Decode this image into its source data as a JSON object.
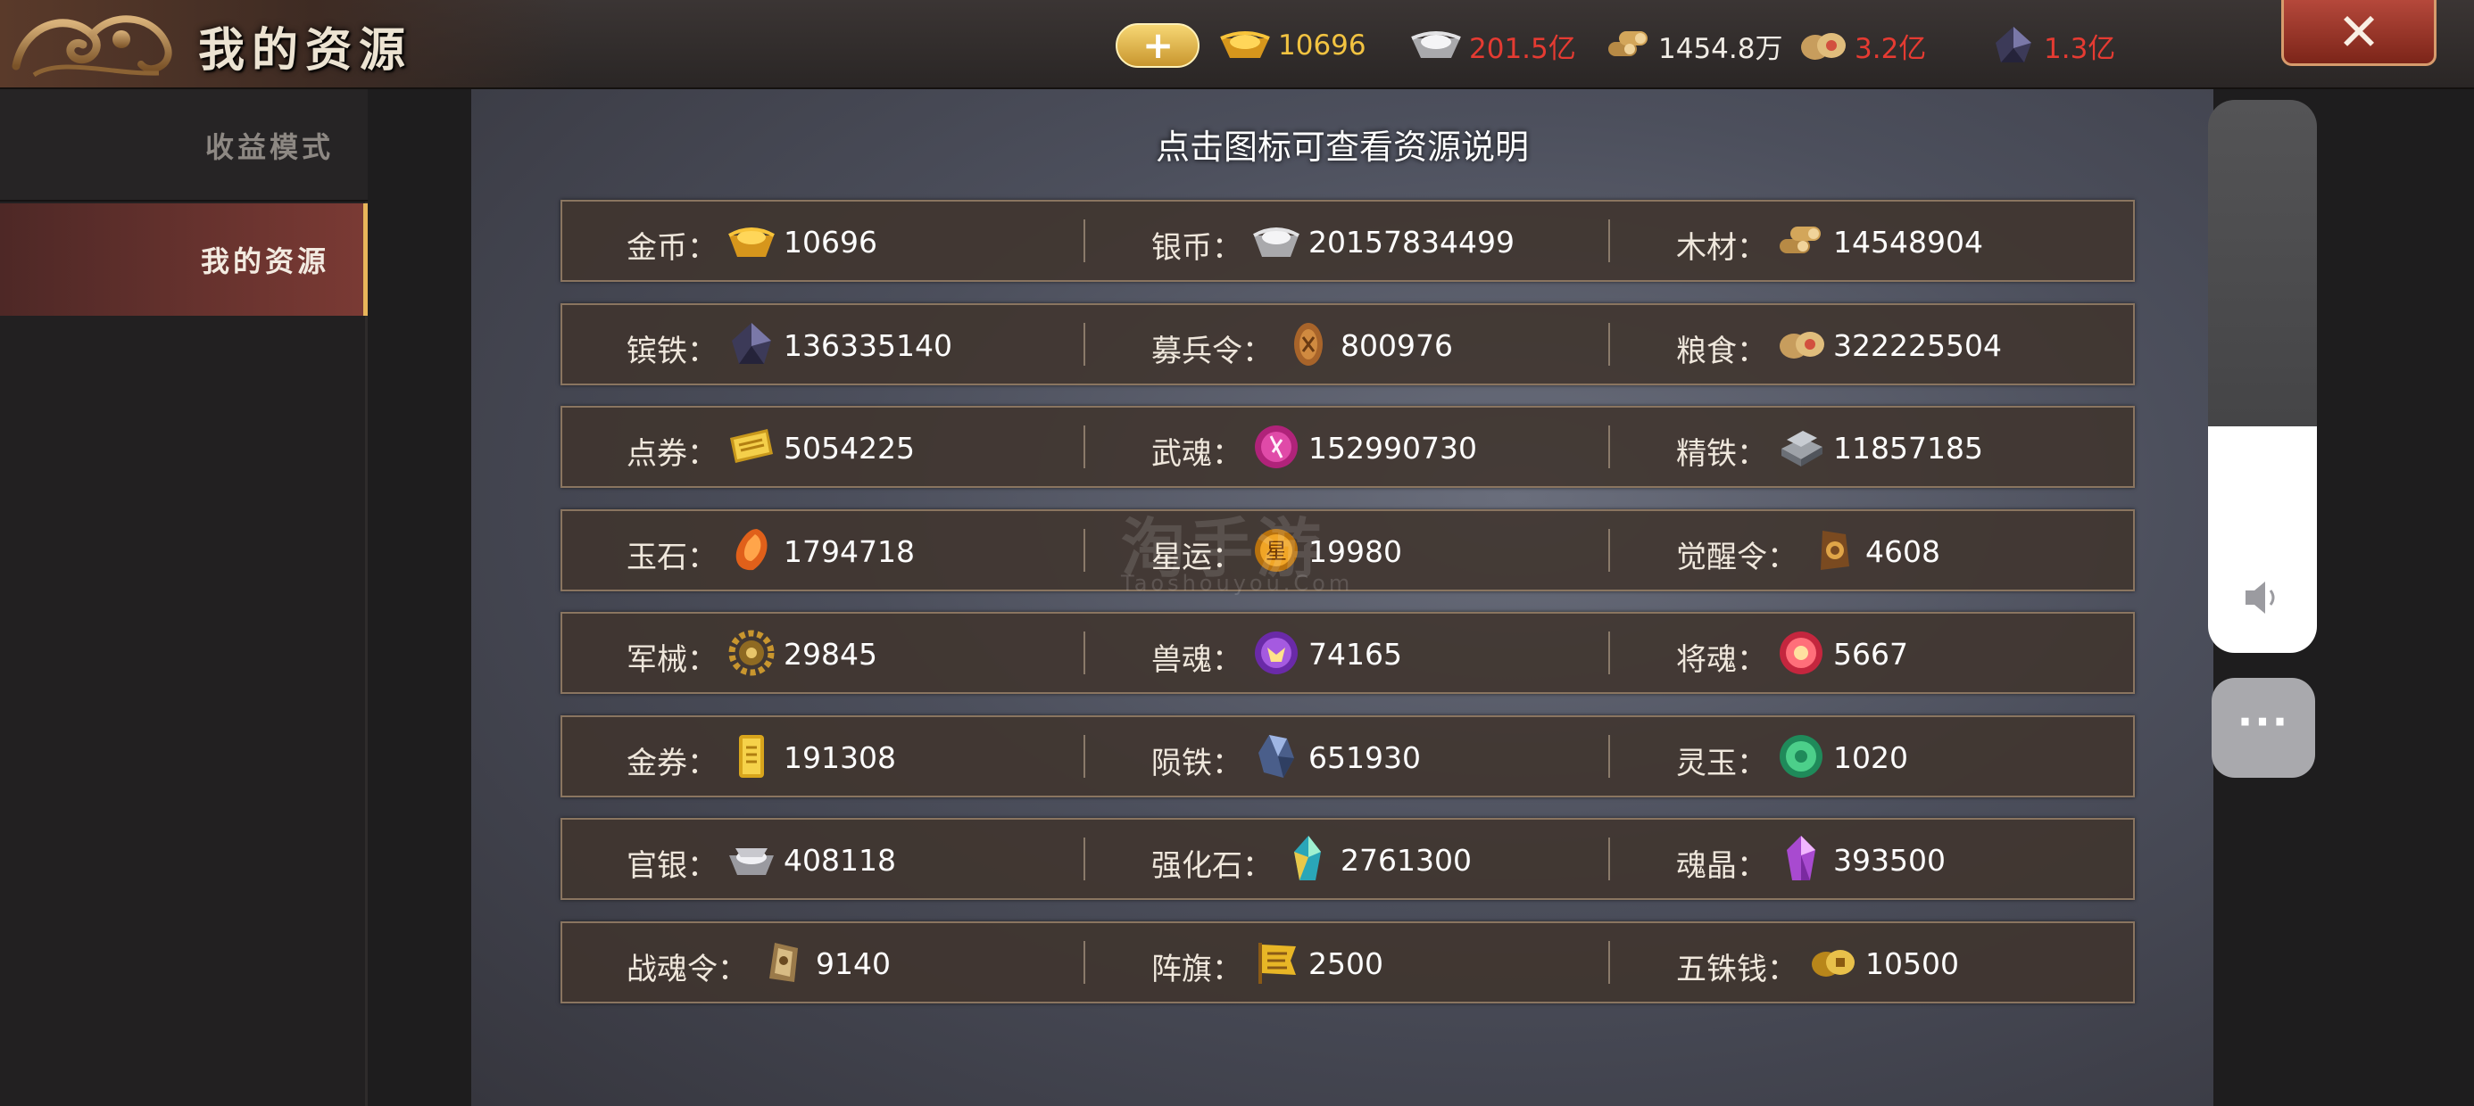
{
  "header": {
    "title": "我的资源",
    "add_button_label": "+",
    "close_label": "✕",
    "currencies": [
      {
        "icon": "gold-ingot-icon",
        "value": "10696",
        "color": "#f2c341"
      },
      {
        "icon": "silver-ingot-icon",
        "value": "201.5亿",
        "color": "#e53b32"
      },
      {
        "icon": "wood-icon",
        "value": "1454.8万",
        "color": "#f1ede6"
      },
      {
        "icon": "grain-icon",
        "value": "3.2亿",
        "color": "#e53b32"
      },
      {
        "icon": "iron-ore-icon",
        "value": "1.3亿",
        "color": "#e53b32"
      }
    ]
  },
  "sidebar": {
    "items": [
      {
        "label": "收益模式",
        "active": false
      },
      {
        "label": "我的资源",
        "active": true
      }
    ]
  },
  "panel": {
    "hint": "点击图标可查看资源说明",
    "rows": [
      [
        {
          "name": "金币：",
          "icon": "gold-ingot-icon",
          "value": "10696"
        },
        {
          "name": "银币：",
          "icon": "silver-ingot-icon",
          "value": "20157834499"
        },
        {
          "name": "木材：",
          "icon": "wood-icon",
          "value": "14548904"
        }
      ],
      [
        {
          "name": "镔铁：",
          "icon": "iron-ore-icon",
          "value": "136335140"
        },
        {
          "name": "募兵令：",
          "icon": "recruit-token-icon",
          "value": "800976"
        },
        {
          "name": "粮食：",
          "icon": "grain-icon",
          "value": "322225504"
        }
      ],
      [
        {
          "name": "点券：",
          "icon": "voucher-icon",
          "value": "5054225"
        },
        {
          "name": "武魂：",
          "icon": "war-soul-icon",
          "value": "152990730"
        },
        {
          "name": "精铁：",
          "icon": "refined-iron-icon",
          "value": "11857185"
        }
      ],
      [
        {
          "name": "玉石：",
          "icon": "jade-stone-icon",
          "value": "1794718"
        },
        {
          "name": "星运：",
          "icon": "star-luck-icon",
          "value": "19980"
        },
        {
          "name": "觉醒令：",
          "icon": "awaken-token-icon",
          "value": "4608"
        }
      ],
      [
        {
          "name": "军械：",
          "icon": "gear-icon",
          "value": "29845"
        },
        {
          "name": "兽魂：",
          "icon": "beast-soul-icon",
          "value": "74165"
        },
        {
          "name": "将魂：",
          "icon": "general-soul-icon",
          "value": "5667"
        }
      ],
      [
        {
          "name": "金券：",
          "icon": "gold-scroll-icon",
          "value": "191308"
        },
        {
          "name": "陨铁：",
          "icon": "meteor-iron-icon",
          "value": "651930"
        },
        {
          "name": "灵玉：",
          "icon": "spirit-jade-icon",
          "value": "1020"
        }
      ],
      [
        {
          "name": "官银：",
          "icon": "official-silver-icon",
          "value": "408118"
        },
        {
          "name": "强化石：",
          "icon": "enhance-stone-icon",
          "value": "2761300"
        },
        {
          "name": "魂晶：",
          "icon": "soul-crystal-icon",
          "value": "393500"
        }
      ],
      [
        {
          "name": "战魂令：",
          "icon": "battle-soul-token-icon",
          "value": "9140"
        },
        {
          "name": "阵旗：",
          "icon": "formation-flag-icon",
          "value": "2500"
        },
        {
          "name": "五铢钱：",
          "icon": "coin-icon",
          "value": "10500"
        }
      ]
    ]
  },
  "watermark": {
    "main": "淘手游",
    "sub": "Taoshouyou.Com"
  },
  "volume": {
    "level": 0.41,
    "icon": "speaker-icon"
  },
  "more_label": "···"
}
